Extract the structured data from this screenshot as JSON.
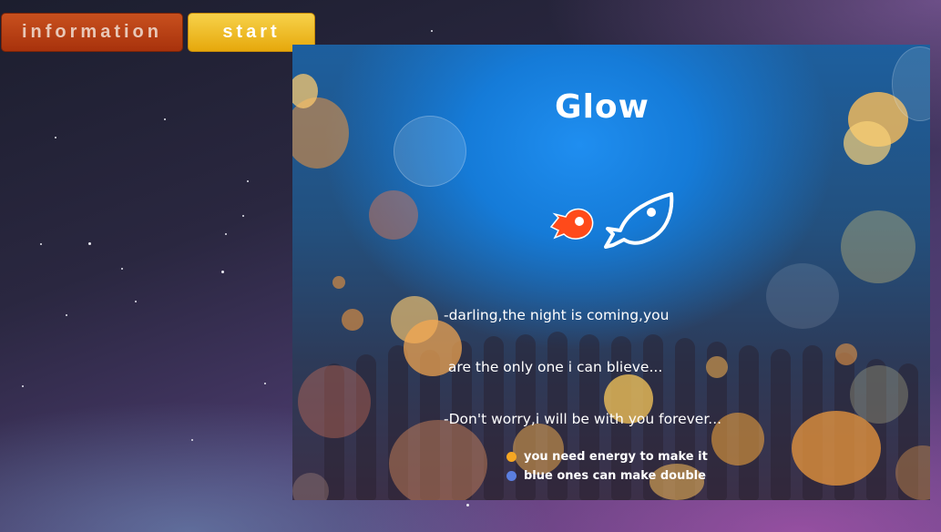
{
  "nav": {
    "information_label": "information",
    "start_label": "start"
  },
  "game": {
    "title": "Glow",
    "story": {
      "line1": "-darling,the night is coming,you",
      "line2": " are the only one i can blieve...",
      "line3": "-Don't worry,i will be with you forever..."
    },
    "hints": {
      "energy": "you need energy to make it",
      "double": "blue ones can make double"
    },
    "icons": {
      "small_fish": "orange-fish-icon",
      "big_fish": "white-fish-icon"
    },
    "colors": {
      "start_button": "#f2c230",
      "information_button": "#b53c14",
      "energy_dot": "#f5a623",
      "double_dot": "#5b7fe0"
    }
  }
}
